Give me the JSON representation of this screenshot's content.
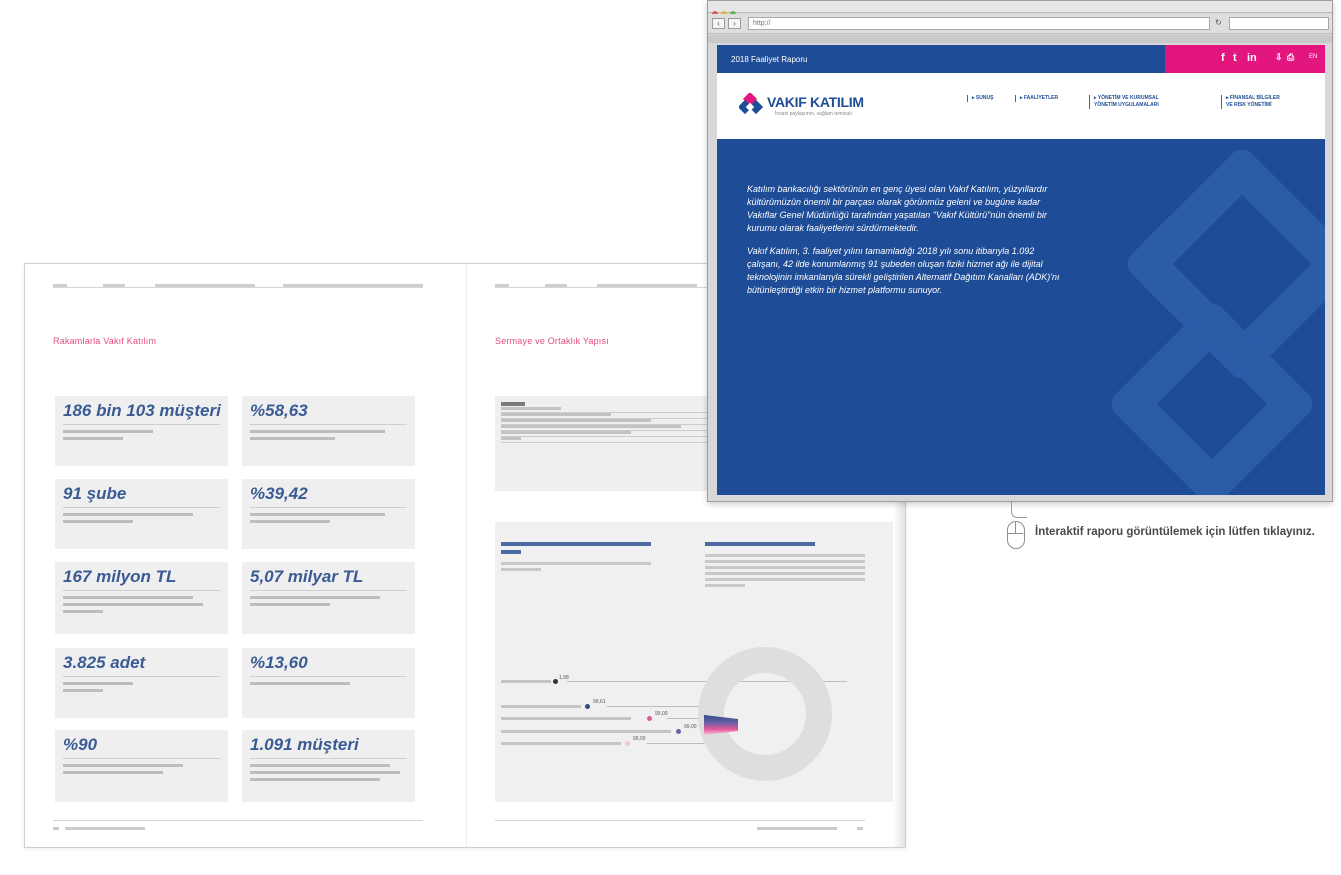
{
  "spread": {
    "left": {
      "section_title": "Rakamlarla Vakıf Katılım",
      "kpis": [
        {
          "value": "186 bin 103 müşteri"
        },
        {
          "value": "%58,63"
        },
        {
          "value": "91 şube"
        },
        {
          "value": "%39,42"
        },
        {
          "value": "167 milyon TL"
        },
        {
          "value": "5,07 milyar TL"
        },
        {
          "value": "3.825 adet"
        },
        {
          "value": "%13,60"
        },
        {
          "value": "%90"
        },
        {
          "value": "1.091 müşteri"
        }
      ]
    },
    "right": {
      "section_title": "Sermaye ve Ortaklık Yapısı",
      "chart_values": [
        "99,61",
        "99,00",
        "99,00",
        "99,00",
        "1,98"
      ]
    }
  },
  "browser": {
    "address": "http://",
    "site": {
      "report_title": "2018 Faaliyet Raporu",
      "social": {
        "facebook": "f",
        "twitter": "t",
        "linkedin": "in"
      },
      "lang": "EN",
      "logo_name": "VAKIF KATILIM",
      "logo_tagline": "İnsani paylaşımın, sağlam teminatı",
      "menu": [
        "▸ SUNUŞ",
        "▸ FAALİYETLER",
        "▸ YÖNETİM VE KURUMSAL\nYÖNETİM UYGULAMALARI",
        "▸ FİNANSAL BİLGİLER\nVE RİSK YÖNETİMİ"
      ],
      "hero_paragraphs": [
        "Katılım bankacılığı sektörünün en genç üyesi olan Vakıf Katılım, yüzyıllardır kültürümüzün önemli bir parçası olarak görünmüz geleni ve bugüne kadar Vakıflar Genel Müdürlüğü tarafından yaşatılan \"Vakıf Kültürü\"nün önemli bir kurumu olarak faaliyetlerini sürdürmektedir.",
        "Vakıf Katılım, 3. faaliyet yılını tamamladığı 2018 yılı sonu itibarıyla 1.092 çalışanı, 42 ilde konumlanmış 91 şubeden oluşan fiziki hizmet ağı ile dijital teknolojinin imkanlarıyla sürekli geliştirilen Alternatif Dağıtım Kanalları (ADK)'nı bütünleştirdiği etkin bir hizmet platformu sunuyor."
      ]
    }
  },
  "cta": {
    "text": "İnteraktif raporu görüntülemek için lütfen tıklayınız."
  },
  "colors": {
    "brand_blue": "#1e4c97",
    "brand_pink": "#e3167f",
    "kpi_blue": "#3a5b94",
    "section_pink": "#e24b86"
  }
}
